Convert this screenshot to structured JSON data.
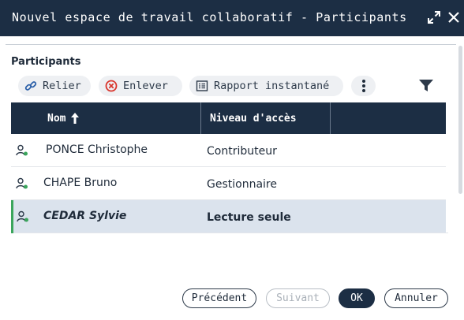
{
  "window": {
    "title": "Nouvel espace de travail collaboratif - Participants"
  },
  "section": {
    "label": "Participants"
  },
  "toolbar": {
    "relier": "Relier",
    "enlever": "Enlever",
    "rapport": "Rapport instantané"
  },
  "table": {
    "columns": [
      "Nom",
      "Niveau d'accès"
    ],
    "sort": "ascending",
    "rows": [
      {
        "name": "PONCE Christophe",
        "level": "Contributeur"
      },
      {
        "name": "CHAPE Bruno",
        "level": "Gestionnaire"
      },
      {
        "name": "CEDAR Sylvie",
        "level": "Lecture seule"
      }
    ],
    "selected_row": 3
  },
  "footer": {
    "previous": "Précédent",
    "next": "Suivant",
    "ok": "OK",
    "cancel": "Annuler"
  },
  "colors": {
    "header_bg": "#1c2e44",
    "selected_row_bg": "#dbe3ed",
    "user_status": "#3ba55c",
    "remove_icon": "#d9342b"
  },
  "icons": [
    "expand-icon",
    "close-icon",
    "link-icon",
    "remove-icon",
    "report-icon",
    "more-vertical-icon",
    "filter-icon",
    "sort-up-icon",
    "user-icon"
  ]
}
